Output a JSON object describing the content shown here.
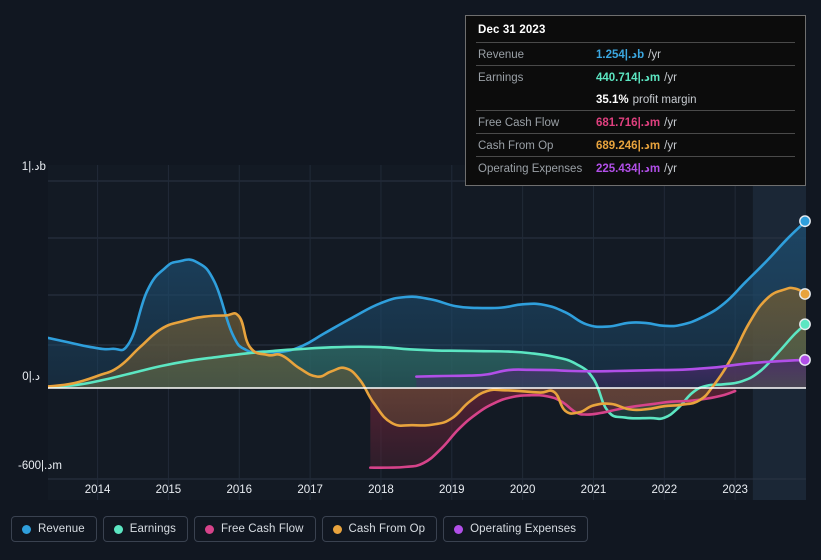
{
  "chart_data": {
    "type": "area",
    "title": "",
    "xlabel": "",
    "ylabel": "",
    "currency": "د.إ",
    "grid": true,
    "legend_position": "bottom",
    "x_ticks": [
      "2014",
      "2015",
      "2016",
      "2017",
      "2018",
      "2019",
      "2020",
      "2021",
      "2022",
      "2023"
    ],
    "y_ticks": [
      {
        "label": "1|.دb",
        "value": 1000
      },
      {
        "label": "0|.د",
        "value": 0
      },
      {
        "label": "-600|.دm",
        "value": -600
      }
    ],
    "ylim": [
      -700,
      1300
    ],
    "xlim": [
      2013.3,
      2024.0
    ],
    "forecast_region": {
      "from": 2023.25,
      "to": 2024.0
    },
    "series": [
      {
        "name": "Revenue",
        "color": "#2f9fdc",
        "fill": "#1d4a6b",
        "end_value": 1254,
        "points": [
          [
            2013.3,
            330
          ],
          [
            2013.6,
            300
          ],
          [
            2013.9,
            270
          ],
          [
            2014.2,
            258
          ],
          [
            2014.45,
            300
          ],
          [
            2014.7,
            640
          ],
          [
            2014.95,
            790
          ],
          [
            2015.15,
            835
          ],
          [
            2015.4,
            830
          ],
          [
            2015.65,
            700
          ],
          [
            2015.9,
            360
          ],
          [
            2016.1,
            250
          ],
          [
            2016.35,
            240
          ],
          [
            2016.6,
            238
          ],
          [
            2016.9,
            280
          ],
          [
            2017.2,
            360
          ],
          [
            2017.6,
            465
          ],
          [
            2018.0,
            560
          ],
          [
            2018.35,
            600
          ],
          [
            2018.7,
            585
          ],
          [
            2019.05,
            540
          ],
          [
            2019.35,
            528
          ],
          [
            2019.7,
            530
          ],
          [
            2020.0,
            552
          ],
          [
            2020.3,
            548
          ],
          [
            2020.6,
            500
          ],
          [
            2020.9,
            420
          ],
          [
            2021.2,
            405
          ],
          [
            2021.5,
            430
          ],
          [
            2021.75,
            428
          ],
          [
            2022.0,
            410
          ],
          [
            2022.25,
            418
          ],
          [
            2022.55,
            470
          ],
          [
            2022.85,
            560
          ],
          [
            2023.15,
            700
          ],
          [
            2023.45,
            840
          ],
          [
            2023.75,
            990
          ],
          [
            2024.0,
            1100
          ]
        ]
      },
      {
        "name": "Earnings",
        "color": "#5ce6c2",
        "fill": "#2f6c63",
        "end_value": 440.714,
        "points": [
          [
            2013.3,
            8
          ],
          [
            2013.7,
            20
          ],
          [
            2014.1,
            55
          ],
          [
            2014.5,
            100
          ],
          [
            2014.9,
            145
          ],
          [
            2015.3,
            180
          ],
          [
            2015.7,
            205
          ],
          [
            2016.1,
            228
          ],
          [
            2016.5,
            245
          ],
          [
            2016.9,
            258
          ],
          [
            2017.3,
            268
          ],
          [
            2017.7,
            272
          ],
          [
            2018.05,
            268
          ],
          [
            2018.4,
            255
          ],
          [
            2018.75,
            248
          ],
          [
            2019.1,
            245
          ],
          [
            2019.45,
            243
          ],
          [
            2019.8,
            240
          ],
          [
            2020.1,
            230
          ],
          [
            2020.45,
            205
          ],
          [
            2020.75,
            160
          ],
          [
            2021.0,
            60
          ],
          [
            2021.2,
            -150
          ],
          [
            2021.45,
            -195
          ],
          [
            2021.8,
            -198
          ],
          [
            2022.0,
            -196
          ],
          [
            2022.2,
            -130
          ],
          [
            2022.4,
            -30
          ],
          [
            2022.6,
            15
          ],
          [
            2022.85,
            25
          ],
          [
            2023.1,
            45
          ],
          [
            2023.35,
            110
          ],
          [
            2023.6,
            230
          ],
          [
            2023.85,
            360
          ],
          [
            2024.0,
            420
          ]
        ]
      },
      {
        "name": "Free Cash Flow",
        "color": "#d6438a",
        "fill": "#5e2336",
        "end_value": 681.716,
        "points": [
          [
            2017.85,
            -525
          ],
          [
            2018.1,
            -525
          ],
          [
            2018.35,
            -520
          ],
          [
            2018.6,
            -495
          ],
          [
            2018.85,
            -400
          ],
          [
            2019.1,
            -270
          ],
          [
            2019.35,
            -170
          ],
          [
            2019.6,
            -100
          ],
          [
            2019.85,
            -60
          ],
          [
            2020.1,
            -48
          ],
          [
            2020.35,
            -55
          ],
          [
            2020.55,
            -90
          ],
          [
            2020.75,
            -160
          ],
          [
            2020.9,
            -175
          ],
          [
            2021.1,
            -165
          ],
          [
            2021.35,
            -140
          ],
          [
            2021.6,
            -120
          ],
          [
            2021.85,
            -105
          ],
          [
            2022.1,
            -90
          ],
          [
            2022.35,
            -85
          ],
          [
            2022.6,
            -70
          ],
          [
            2022.85,
            -45
          ],
          [
            2023.0,
            -20
          ]
        ]
      },
      {
        "name": "Cash From Op",
        "color": "#e8a33d",
        "fill": "#6b5a36",
        "end_value": 689.246,
        "points": [
          [
            2013.3,
            10
          ],
          [
            2013.65,
            30
          ],
          [
            2014.0,
            80
          ],
          [
            2014.3,
            140
          ],
          [
            2014.6,
            270
          ],
          [
            2014.9,
            390
          ],
          [
            2015.2,
            440
          ],
          [
            2015.5,
            470
          ],
          [
            2015.8,
            478
          ],
          [
            2016.0,
            470
          ],
          [
            2016.15,
            270
          ],
          [
            2016.4,
            218
          ],
          [
            2016.6,
            215
          ],
          [
            2016.85,
            130
          ],
          [
            2017.1,
            75
          ],
          [
            2017.3,
            110
          ],
          [
            2017.5,
            130
          ],
          [
            2017.7,
            55
          ],
          [
            2017.9,
            -100
          ],
          [
            2018.15,
            -230
          ],
          [
            2018.45,
            -245
          ],
          [
            2018.75,
            -240
          ],
          [
            2019.0,
            -200
          ],
          [
            2019.25,
            -90
          ],
          [
            2019.5,
            -20
          ],
          [
            2019.75,
            -15
          ],
          [
            2020.0,
            -22
          ],
          [
            2020.25,
            -30
          ],
          [
            2020.45,
            -28
          ],
          [
            2020.6,
            -150
          ],
          [
            2020.8,
            -160
          ],
          [
            2021.0,
            -115
          ],
          [
            2021.25,
            -105
          ],
          [
            2021.5,
            -140
          ],
          [
            2021.75,
            -140
          ],
          [
            2022.0,
            -120
          ],
          [
            2022.25,
            -110
          ],
          [
            2022.5,
            -80
          ],
          [
            2022.7,
            20
          ],
          [
            2022.95,
            200
          ],
          [
            2023.2,
            430
          ],
          [
            2023.45,
            590
          ],
          [
            2023.7,
            650
          ],
          [
            2023.85,
            655
          ],
          [
            2024.0,
            620
          ]
        ]
      },
      {
        "name": "Operating Expenses",
        "color": "#b14fe8",
        "fill": "#4a2a6b",
        "end_value": 225.434,
        "points": [
          [
            2018.5,
            75
          ],
          [
            2018.75,
            78
          ],
          [
            2019.0,
            80
          ],
          [
            2019.25,
            82
          ],
          [
            2019.5,
            90
          ],
          [
            2019.8,
            118
          ],
          [
            2020.1,
            120
          ],
          [
            2020.4,
            118
          ],
          [
            2020.7,
            112
          ],
          [
            2021.0,
            110
          ],
          [
            2021.3,
            112
          ],
          [
            2021.6,
            115
          ],
          [
            2021.9,
            118
          ],
          [
            2022.2,
            120
          ],
          [
            2022.5,
            128
          ],
          [
            2022.8,
            140
          ],
          [
            2023.1,
            158
          ],
          [
            2023.45,
            172
          ],
          [
            2023.75,
            180
          ],
          [
            2024.0,
            185
          ]
        ]
      }
    ]
  },
  "tooltip": {
    "date": "Dec 31 2023",
    "rows": [
      {
        "label": "Revenue",
        "value": "1.254|.دb",
        "unit": "/yr",
        "color_key": "rev"
      },
      {
        "label": "Earnings",
        "value": "440.714|.دm",
        "unit": "/yr",
        "color_key": "earn"
      },
      {
        "label": "",
        "value": "35.1%",
        "unit": "profit margin",
        "color_key": "margin"
      },
      {
        "label": "Free Cash Flow",
        "value": "681.716|.دm",
        "unit": "/yr",
        "color_key": "fcf"
      },
      {
        "label": "Cash From Op",
        "value": "689.246|.دm",
        "unit": "/yr",
        "color_key": "cfo"
      },
      {
        "label": "Operating Expenses",
        "value": "225.434|.دm",
        "unit": "/yr",
        "color_key": "opex"
      }
    ]
  },
  "legend": {
    "items": [
      {
        "label": "Revenue",
        "color": "#2f9fdc"
      },
      {
        "label": "Earnings",
        "color": "#5ce6c2"
      },
      {
        "label": "Free Cash Flow",
        "color": "#d6438a"
      },
      {
        "label": "Cash From Op",
        "color": "#e8a33d"
      },
      {
        "label": "Operating Expenses",
        "color": "#b14fe8"
      }
    ]
  },
  "axes": {
    "y_top_label": "1|.دb",
    "y_zero_label": "0|.د",
    "y_bottom_label": "-600|.دm"
  }
}
